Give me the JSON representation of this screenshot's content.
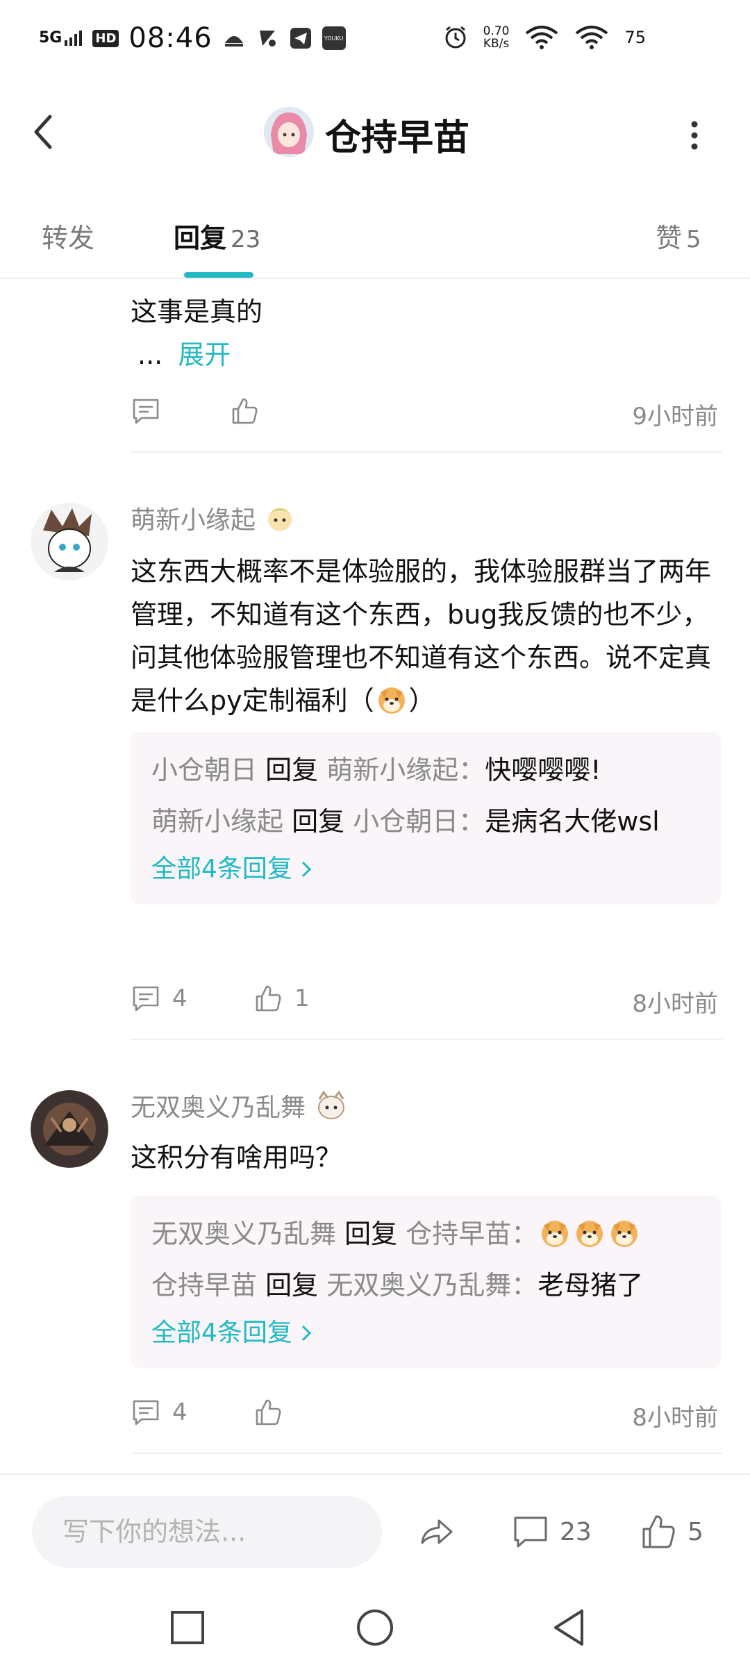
{
  "status_bar": {
    "network": "5G",
    "hd": "HD",
    "time": "08:46",
    "app_badge": "YOUKU",
    "speed_value": "0.70",
    "speed_unit": "KB/s",
    "battery": "75"
  },
  "header": {
    "title": "仓持早苗"
  },
  "tabs": [
    {
      "label": "转发",
      "count": ""
    },
    {
      "label": "回复",
      "count": "23"
    },
    {
      "label": "赞",
      "count": "5"
    }
  ],
  "comments": [
    {
      "text_line": "这事是真的",
      "ellipsis": "...",
      "expand_label": "展开",
      "reply_count": "",
      "like_count": "",
      "time": "9小时前"
    },
    {
      "username": "萌新小缘起",
      "text_parts": [
        "这东西大概率不是体验服的，我体验服群当了两年管理，不知道有这个东西，bug我反馈的也不少，问其他体验服管理也不知道有这个东西。说不定真是什么py定制福利（",
        "）"
      ],
      "replies": [
        {
          "from": "小仓朝日",
          "verb": "回复",
          "to": "萌新小缘起",
          "sep": "：",
          "text": "快嘤嘤嘤!"
        },
        {
          "from": "萌新小缘起",
          "verb": "回复",
          "to": "小仓朝日",
          "sep": "：",
          "text": "是病名大佬wsl"
        }
      ],
      "more_replies": "全部4条回复",
      "reply_count": "4",
      "like_count": "1",
      "time": "8小时前"
    },
    {
      "username": "无双奥义乃乱舞",
      "text": "这积分有啥用吗？",
      "replies": [
        {
          "from": "无双奥义乃乱舞",
          "verb": "回复",
          "to": "仓持早苗",
          "sep": "：",
          "text": ""
        },
        {
          "from": "仓持早苗",
          "verb": "回复",
          "to": "无双奥义乃乱舞",
          "sep": "：",
          "text": "老母猪了"
        }
      ],
      "more_replies": "全部4条回复",
      "reply_count": "4",
      "like_count": "",
      "time": "8小时前"
    }
  ],
  "bottom_bar": {
    "input_placeholder": "写下你的想法...",
    "reply_count": "23",
    "like_count": "5"
  },
  "colors": {
    "accent": "#21b9c3",
    "muted": "#8a8a8a",
    "reply_bg": "#f9f5f9"
  }
}
